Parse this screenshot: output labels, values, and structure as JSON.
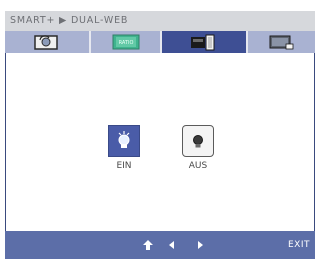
{
  "header": {
    "title": "SMART+ ▶ DUAL-WEB"
  },
  "tabs": [
    {
      "icon": "monitor-rotate-icon",
      "active": false
    },
    {
      "icon": "ratio-icon",
      "active": false
    },
    {
      "icon": "dual-web-icon",
      "active": true
    },
    {
      "icon": "monitor-settings-icon",
      "active": false
    }
  ],
  "main": {
    "options": [
      {
        "label": "EIN",
        "icon": "bulb-on-icon",
        "selected": true
      },
      {
        "label": "AUS",
        "icon": "bulb-off-icon",
        "selected": false
      }
    ]
  },
  "footer": {
    "buttons": [
      {
        "icon": "up-arrow-icon"
      },
      {
        "icon": "left-arrow-icon"
      },
      {
        "icon": "right-arrow-icon"
      }
    ],
    "exit_label": "EXIT"
  },
  "colors": {
    "accent": "#5c6ea8",
    "header_bg": "#d6d8dc",
    "active_tab": "#3e4f94",
    "inactive_tab": "#a9b2d2"
  }
}
